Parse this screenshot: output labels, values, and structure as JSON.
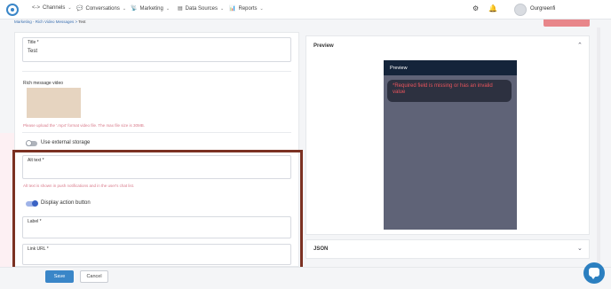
{
  "nav": {
    "items": [
      {
        "icon": "<->",
        "label": "Channels"
      },
      {
        "icon": "💬",
        "label": "Conversations"
      },
      {
        "icon": "📡",
        "label": "Marketing"
      },
      {
        "icon": "▤",
        "label": "Data Sources"
      },
      {
        "icon": "📊",
        "label": "Reports"
      }
    ],
    "username": "Ourgreenfi"
  },
  "breadcrumb": {
    "parent": "Marketing",
    "section": "Rich Video Messages",
    "current": "Test"
  },
  "form": {
    "title_label": "Title *",
    "title_value": "Test",
    "video_label": "Rich message video",
    "video_help": "Please upload the '.mp4' format video file. The max file size is 30MB.",
    "external_storage_label": "Use external storage",
    "alt_text_label": "Alt text *",
    "alt_text_value": "",
    "alt_text_help": "Alt text is shown in push notifications and in the user's chat list.",
    "display_action_label": "Display action button",
    "button_label_label": "Label *",
    "button_label_value": "",
    "link_url_label": "Link URL *",
    "link_url_value": ""
  },
  "footer": {
    "save": "Save",
    "cancel": "Cancel"
  },
  "preview": {
    "title": "Preview",
    "phone_header": "Preview",
    "error_message": "*Required field is missing or has an invalid value"
  },
  "json_panel": {
    "title": "JSON"
  },
  "colors": {
    "accent": "#3a86c8",
    "error": "#e9545c",
    "highlight_border": "#7b3122"
  }
}
